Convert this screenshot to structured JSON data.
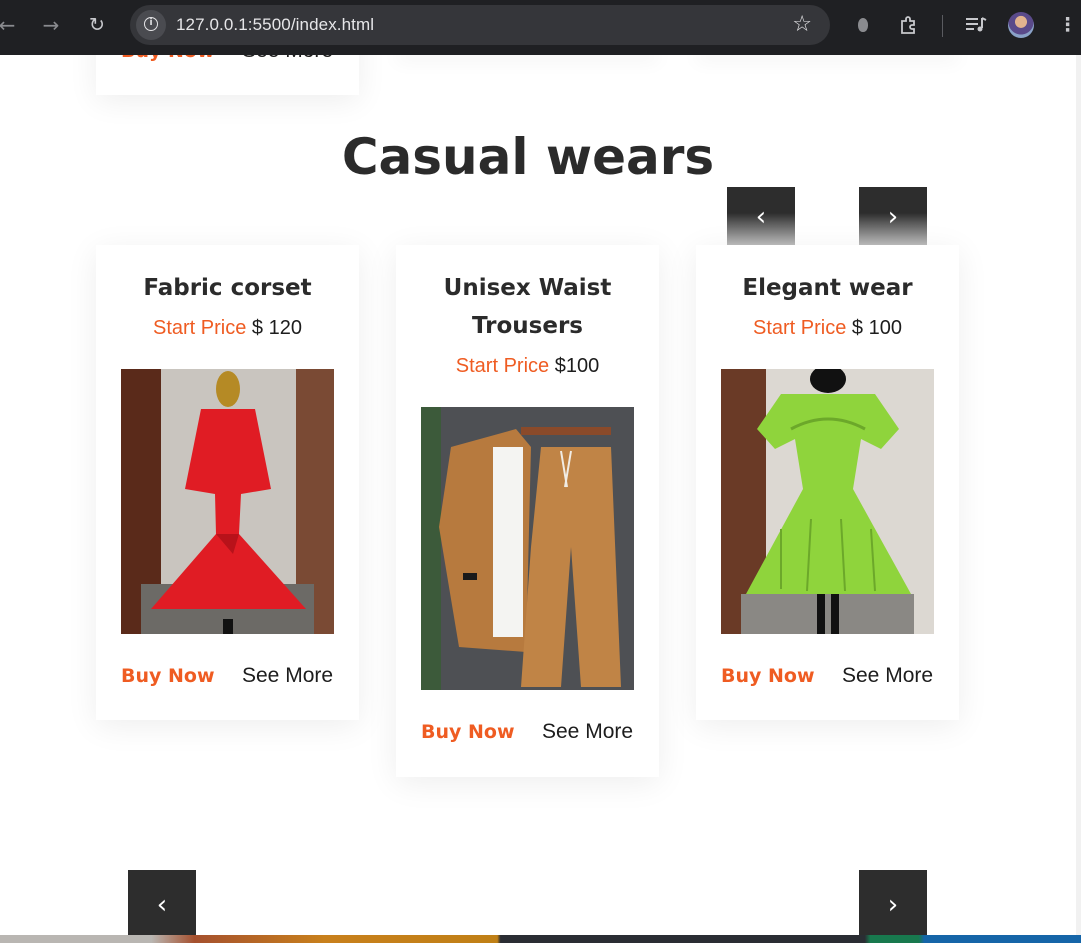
{
  "browser": {
    "url": "127.0.0.1:5500/index.html"
  },
  "colors": {
    "accent": "#ef5c22",
    "heading": "#2b2b2b",
    "arrow_bg": "#2d2d2d"
  },
  "section": {
    "title": "Casual wears"
  },
  "top_partial_card": {
    "buy_label": "Buy Now",
    "see_label": "See More"
  },
  "products": [
    {
      "name": "Fabric corset",
      "price_label": "Start Price",
      "price": "$ 120",
      "buy_label": "Buy Now",
      "see_label": "See More",
      "image": "red-corset-dress-photo"
    },
    {
      "name": "Unisex Waist Trousers",
      "price_label": "Start Price",
      "price": "$100",
      "buy_label": "Buy Now",
      "see_label": "See More",
      "image": "brown-shirt-trousers-set-photo"
    },
    {
      "name": "Elegant wear",
      "price_label": "Start Price",
      "price": "$ 100",
      "buy_label": "Buy Now",
      "see_label": "See More",
      "image": "green-floral-dress-photo"
    }
  ],
  "icons": {
    "prev": "‹",
    "next": "›"
  }
}
